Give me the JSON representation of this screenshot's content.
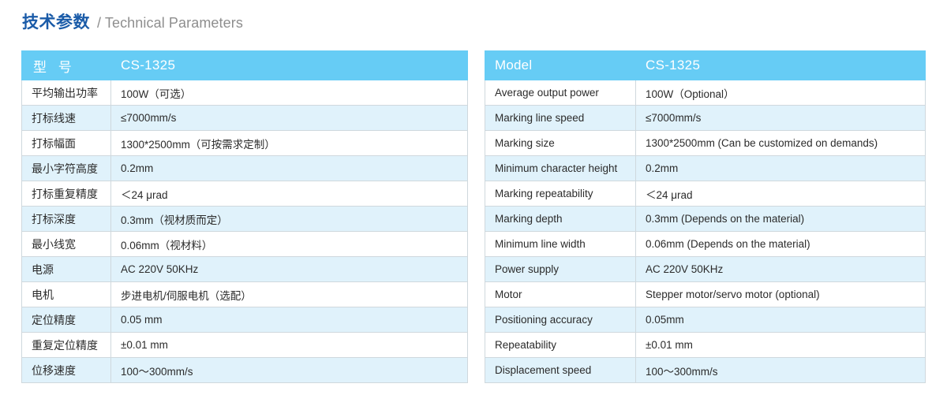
{
  "title": {
    "cn": "技术参数",
    "en": "/ Technical Parameters"
  },
  "colors": {
    "header_blue": "#66ccf5",
    "stripe_blue": "#e0f2fb",
    "title_navy": "#1a5ba8",
    "title_gray": "#8e8e8e",
    "border_gray": "#cfd8dd"
  },
  "table_cn": {
    "header": {
      "label": "型 号",
      "value": "CS-1325"
    },
    "rows": [
      {
        "label": "平均输出功率",
        "value": "100W（可选）"
      },
      {
        "label": "打标线速",
        "value": "≤7000mm/s"
      },
      {
        "label": "打标幅面",
        "value": "1300*2500mm（可按需求定制）"
      },
      {
        "label": "最小字符高度",
        "value": "0.2mm"
      },
      {
        "label": "打标重复精度",
        "value": "＜24 μrad"
      },
      {
        "label": "打标深度",
        "value": "0.3mm（视材质而定）"
      },
      {
        "label": "最小线宽",
        "value": "0.06mm（视材料）"
      },
      {
        "label": "电源",
        "value": "AC 220V 50KHz"
      },
      {
        "label": "电机",
        "value": "步进电机/伺服电机（选配）"
      },
      {
        "label": "定位精度",
        "value": "0.05 mm"
      },
      {
        "label": "重复定位精度",
        "value": "±0.01 mm"
      },
      {
        "label": "位移速度",
        "value": "100～300mm/s"
      }
    ]
  },
  "table_en": {
    "header": {
      "label": "Model",
      "value": "CS-1325"
    },
    "rows": [
      {
        "label": "Average output power",
        "value": "100W（Optional）"
      },
      {
        "label": "Marking line speed",
        "value": "≤7000mm/s"
      },
      {
        "label": "Marking size",
        "value": "1300*2500mm (Can be customized on demands)"
      },
      {
        "label": "Minimum character height",
        "value": "0.2mm"
      },
      {
        "label": "Marking repeatability",
        "value": "＜24 μrad"
      },
      {
        "label": "Marking depth",
        "value": "0.3mm (Depends on the material)"
      },
      {
        "label": "Minimum line width",
        "value": "0.06mm (Depends on the material)"
      },
      {
        "label": "Power supply",
        "value": "AC 220V 50KHz"
      },
      {
        "label": "Motor",
        "value": "Stepper motor/servo motor (optional)"
      },
      {
        "label": "Positioning accuracy",
        "value": "0.05mm"
      },
      {
        "label": "Repeatability",
        "value": "±0.01 mm"
      },
      {
        "label": "Displacement speed",
        "value": "100～300mm/s"
      }
    ]
  }
}
